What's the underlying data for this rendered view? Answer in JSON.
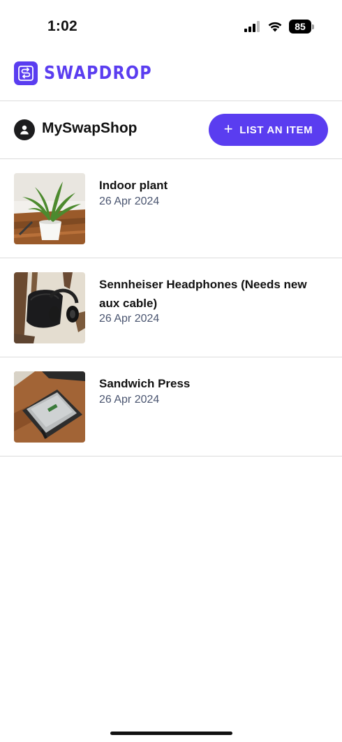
{
  "status_bar": {
    "time": "1:02",
    "battery": "85",
    "icons": [
      "signal-icon",
      "wifi-icon",
      "battery-icon"
    ]
  },
  "brand": {
    "name": "SWAPDROP",
    "logo_icon": "swap-arrows-icon",
    "color": "#5a3df0"
  },
  "shop": {
    "name": "MySwapShop",
    "avatar_icon": "person-icon",
    "list_button_label": "LIST AN ITEM",
    "list_button_icon": "plus-icon"
  },
  "items": [
    {
      "title": "Indoor plant",
      "date": "26 Apr 2024",
      "thumbnail": "plant-photo"
    },
    {
      "title": "Sennheiser Headphones (Needs new aux cable)",
      "date": "26 Apr 2024",
      "thumbnail": "headphones-photo"
    },
    {
      "title": "Sandwich Press",
      "date": "26 Apr 2024",
      "thumbnail": "sandwich-press-photo"
    }
  ],
  "colors": {
    "accent": "#5a3df0",
    "date_text": "#4a5570",
    "divider": "#dcdcdc"
  }
}
